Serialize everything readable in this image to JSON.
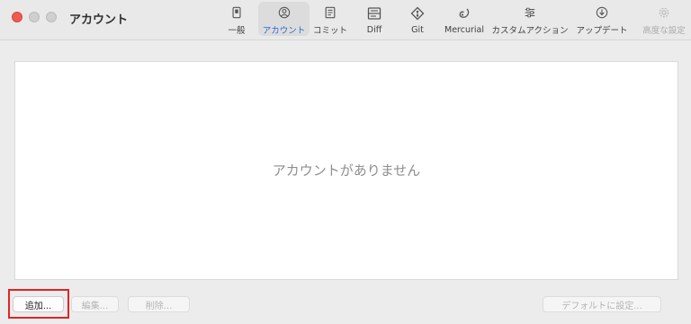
{
  "window": {
    "title": "アカウント"
  },
  "toolbar": {
    "items": [
      {
        "label": "一般",
        "icon": "general-icon",
        "state": "normal"
      },
      {
        "label": "アカウント",
        "icon": "account-icon",
        "state": "active"
      },
      {
        "label": "コミット",
        "icon": "commit-icon",
        "state": "normal"
      },
      {
        "label": "Diff",
        "icon": "diff-icon",
        "state": "normal"
      },
      {
        "label": "Git",
        "icon": "git-icon",
        "state": "normal"
      },
      {
        "label": "Mercurial",
        "icon": "mercurial-icon",
        "state": "normal"
      },
      {
        "label": "カスタムアクション",
        "icon": "custom-actions-icon",
        "state": "normal"
      },
      {
        "label": "アップデート",
        "icon": "update-icon",
        "state": "normal"
      },
      {
        "label": "高度な設定",
        "icon": "advanced-icon",
        "state": "disabled"
      }
    ]
  },
  "main": {
    "empty_message": "アカウントがありません"
  },
  "buttons": {
    "add": "追加...",
    "edit": "編集...",
    "delete": "削除...",
    "set_default": "デフォルトに設定..."
  },
  "colors": {
    "accent": "#2f6bd6",
    "highlight": "#e52323",
    "close": "#ee5b53"
  }
}
